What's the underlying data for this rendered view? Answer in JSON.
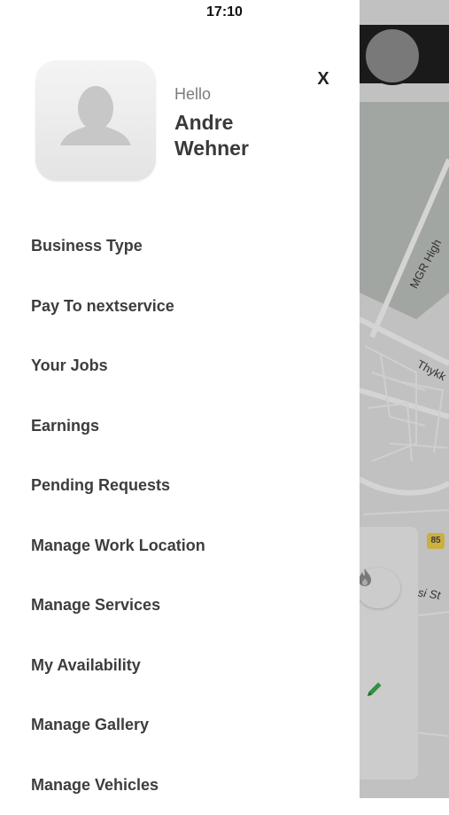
{
  "status_bar": {
    "time": "17:10"
  },
  "profile": {
    "greeting": "Hello",
    "name": "Andre Wehner",
    "avatar_icon": "person-placeholder-icon"
  },
  "close_label": "X",
  "menu": {
    "items": [
      {
        "label": "Business Type"
      },
      {
        "label": "Pay To nextservice"
      },
      {
        "label": "Your Jobs"
      },
      {
        "label": "Earnings"
      },
      {
        "label": "Pending Requests"
      },
      {
        "label": "Manage Work Location"
      },
      {
        "label": "Manage Services"
      },
      {
        "label": "My Availability"
      },
      {
        "label": "Manage Gallery"
      },
      {
        "label": "Manage Vehicles"
      }
    ]
  },
  "map": {
    "road_labels": [
      "MGR High",
      "Thykk",
      "si St"
    ],
    "route_shield": "85",
    "icons": [
      "flame-icon",
      "pencil-icon"
    ]
  },
  "colors": {
    "menu_text": "#3d3d3d",
    "name_text": "#3a3a3a",
    "greeting_text": "#7b7b7b",
    "accent_green": "#3aa64a"
  }
}
